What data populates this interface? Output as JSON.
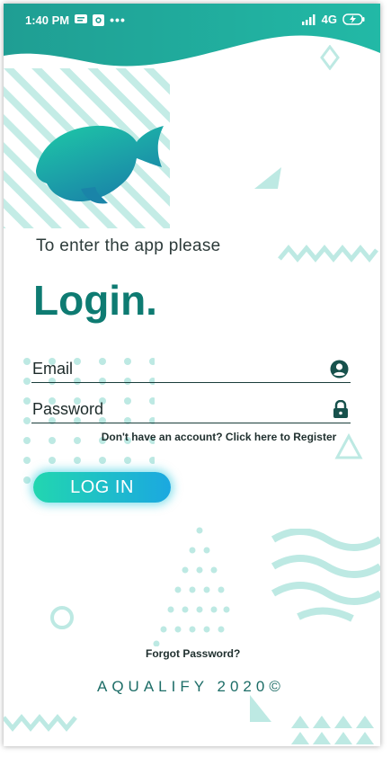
{
  "status_bar": {
    "time": "1:40 PM",
    "network": "4G",
    "left_icons": [
      "message-icon",
      "record-icon",
      "more-dots-icon"
    ],
    "right_icons": [
      "signal-icon",
      "battery-charging-icon"
    ]
  },
  "login": {
    "subtitle": "To enter the app please",
    "title": "Login.",
    "email_placeholder": "Email",
    "email_icon": "user-circle-icon",
    "password_placeholder": "Password",
    "password_icon": "lock-icon",
    "register_text": "Don't have an account? Click here to Register",
    "button_label": "LOG IN",
    "forgot_text": "Forgot Password?"
  },
  "footer": {
    "text": "AQUALIFY 2020©"
  },
  "colors": {
    "primary": "#0e7b72",
    "accent_start": "#22d6b0",
    "accent_end": "#1ba8e0",
    "decor": "#bde9e3"
  }
}
